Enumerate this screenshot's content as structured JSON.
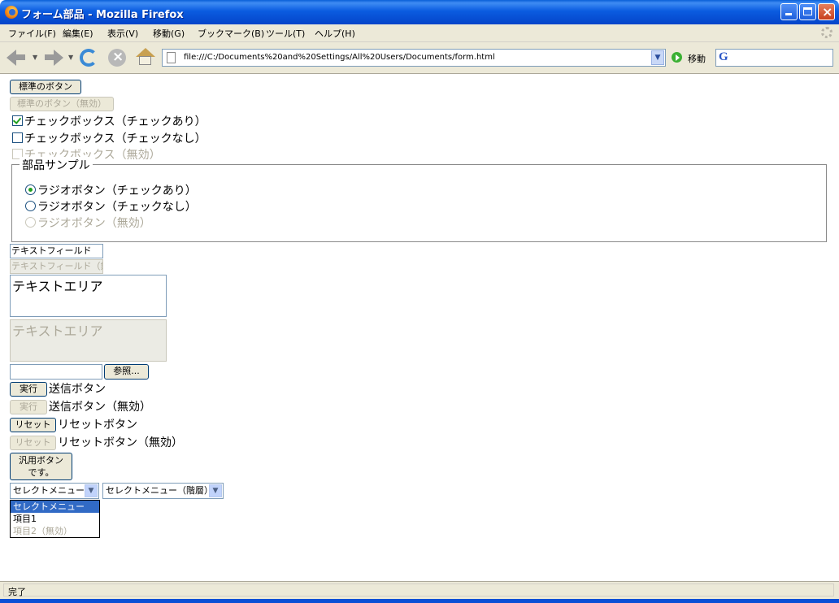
{
  "window": {
    "title": "フォーム部品 - Mozilla Firefox",
    "accent": "#0a5fd8"
  },
  "menubar": {
    "items": [
      "ファイル(F)",
      "編集(E)",
      "表示(V)",
      "移動(G)",
      "ブックマーク(B)",
      "ツール(T)",
      "ヘルプ(H)"
    ]
  },
  "toolbar": {
    "icons": [
      "back-arrow",
      "forward-arrow",
      "reload",
      "stop",
      "home"
    ],
    "url": "file:///C:/Documents%20and%20Settings/All%20Users/Documents/form.html",
    "go_label": "移動",
    "search_engine_icon": "G"
  },
  "content": {
    "buttons": {
      "standard": "標準のボタン",
      "standard_disabled": "標準のボタン（無効）"
    },
    "checkboxes": [
      {
        "label": "チェックボックス（チェックあり）",
        "checked": true,
        "disabled": false
      },
      {
        "label": "チェックボックス（チェックなし）",
        "checked": false,
        "disabled": false
      },
      {
        "label": "チェックボックス（無効）",
        "checked": false,
        "disabled": true
      }
    ],
    "fieldset": {
      "legend": "部品サンプル",
      "radios": [
        {
          "label": "ラジオボタン（チェックあり）",
          "checked": true,
          "disabled": false
        },
        {
          "label": "ラジオボタン（チェックなし）",
          "checked": false,
          "disabled": false
        },
        {
          "label": "ラジオボタン（無効）",
          "checked": false,
          "disabled": true
        }
      ]
    },
    "text_field": {
      "value": "テキストフィールド"
    },
    "text_field_disabled": {
      "value": "テキストフィールド（無効）"
    },
    "textarea": {
      "value": "テキストエリア"
    },
    "textarea_disabled": {
      "value": "テキストエリア"
    },
    "file_input": {
      "value": "",
      "browse_label": "参照..."
    },
    "submit": {
      "button": "実行",
      "label": "送信ボタン"
    },
    "submit_disabled": {
      "button": "実行",
      "label": "送信ボタン（無効）"
    },
    "reset": {
      "button": "リセット",
      "label": "リセットボタン"
    },
    "reset_disabled": {
      "button": "リセット",
      "label": "リセットボタン（無効）"
    },
    "generic_button": {
      "line1": "汎用ボタン",
      "line2": "です。"
    },
    "select_menu": {
      "selected": "セレクトメニュー",
      "options": [
        {
          "label": "セレクトメニュー",
          "highlighted": true,
          "disabled": false
        },
        {
          "label": "項目1",
          "highlighted": false,
          "disabled": false
        },
        {
          "label": "項目2（無効）",
          "highlighted": false,
          "disabled": true
        }
      ]
    },
    "select_menu_grouped": {
      "selected": "セレクトメニュー（階層）"
    }
  },
  "status": {
    "text": "完了"
  }
}
